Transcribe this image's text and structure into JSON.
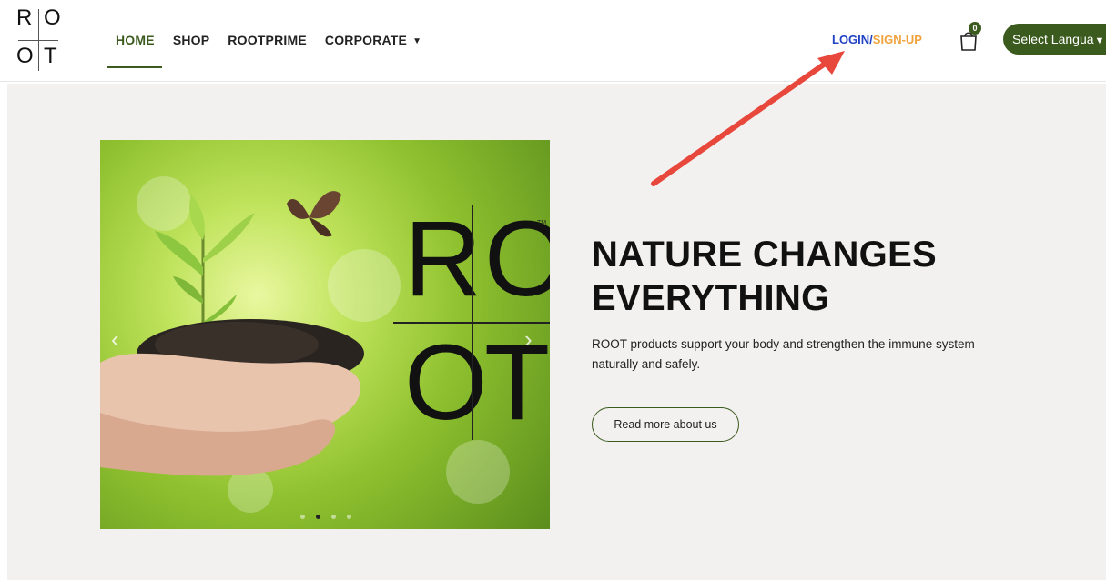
{
  "logo": {
    "letters": [
      "R",
      "O",
      "O",
      "T"
    ]
  },
  "nav": {
    "items": [
      {
        "label": "HOME",
        "active": true
      },
      {
        "label": "SHOP",
        "active": false
      },
      {
        "label": "ROOTPRIME",
        "active": false
      },
      {
        "label": "CORPORATE",
        "active": false,
        "has_dropdown": true
      }
    ]
  },
  "auth": {
    "login": "LOGIN",
    "separator": "/",
    "signup": "SIGN-UP"
  },
  "cart": {
    "count": "0",
    "icon": "shopping-bag-icon"
  },
  "language": {
    "label": "Select Langua"
  },
  "hero": {
    "title_line1": "NATURE CHANGES",
    "title_line2": "EVERYTHING",
    "text_line1": "ROOT products support your body and strengthen the immune system",
    "text_line2": "naturally and safely.",
    "button": "Read more about us"
  },
  "slider": {
    "logo_letters": [
      "R",
      "O",
      "O",
      "T"
    ],
    "trademark": "TM",
    "current_slide": 2,
    "slide_count": 4
  },
  "colors": {
    "brand_green": "#3b5a1d",
    "login_blue": "#2143c4",
    "signup_orange": "#f0a23c",
    "annotation_red": "#e8473c",
    "page_bg": "#f2f1ef"
  }
}
